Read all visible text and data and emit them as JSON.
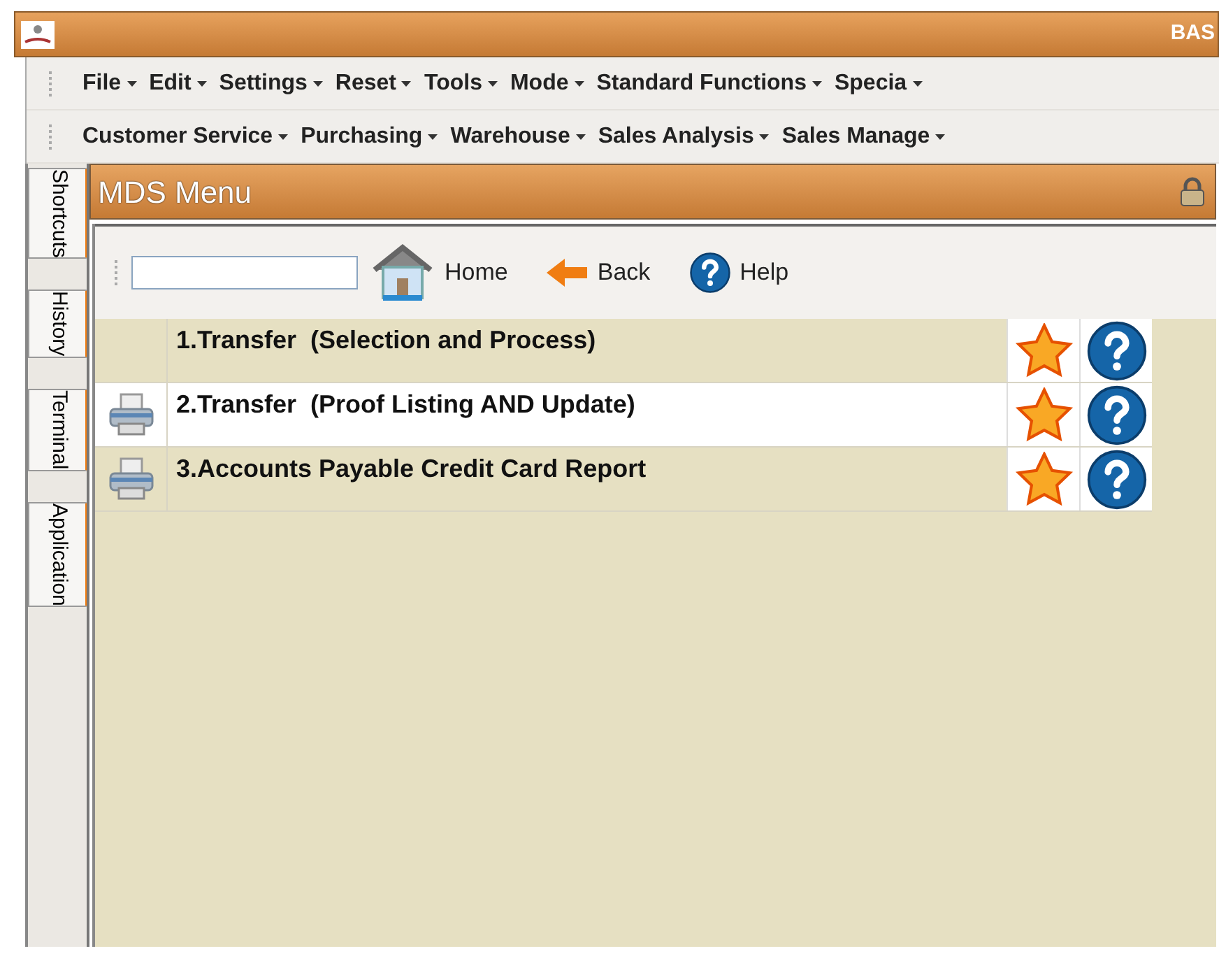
{
  "window": {
    "title": "BAS"
  },
  "menubar": [
    [
      "File",
      "Edit",
      "Settings",
      "Reset",
      "Tools",
      "Mode",
      "Standard Functions",
      "Specia"
    ],
    [
      "Customer Service",
      "Purchasing",
      "Warehouse",
      "Sales Analysis",
      "Sales Manage"
    ]
  ],
  "side_tabs": [
    {
      "label": "Shortcuts"
    },
    {
      "label": "History"
    },
    {
      "label": "Terminal"
    },
    {
      "label": "Application"
    }
  ],
  "panel": {
    "title": "MDS Menu",
    "toolbar": {
      "buttons": [
        {
          "kind": "home",
          "label": "Home"
        },
        {
          "kind": "back",
          "label": "Back"
        },
        {
          "kind": "help",
          "label": "Help"
        }
      ]
    },
    "items": [
      {
        "label": "1.Transfer  (Selection and Process)",
        "printer": false
      },
      {
        "label": "2.Transfer  (Proof Listing AND Update)",
        "printer": true
      },
      {
        "label": "3.Accounts Payable Credit Card Report",
        "printer": true
      }
    ]
  }
}
